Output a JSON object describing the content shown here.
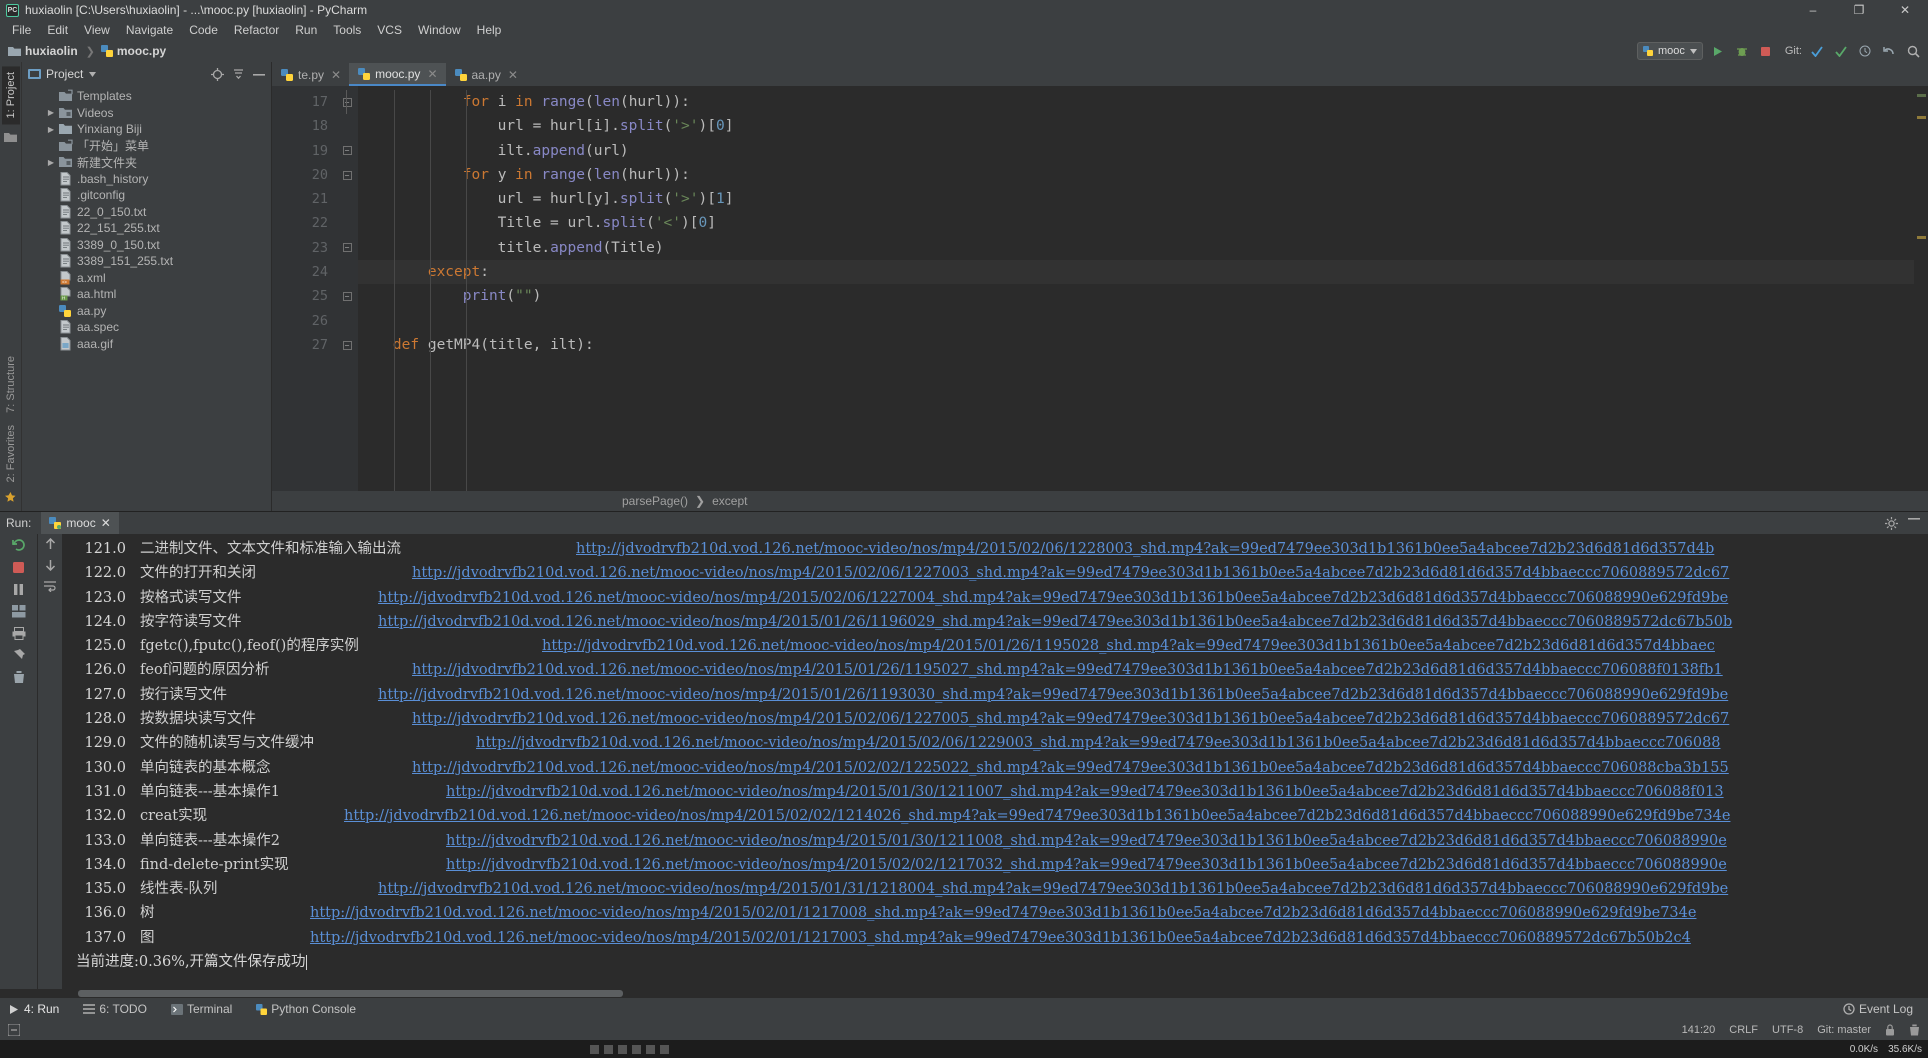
{
  "titlebar": {
    "title": "huxiaolin [C:\\Users\\huxiaolin] - ...\\mooc.py [huxiaolin] - PyCharm",
    "minimize": "–",
    "maximize": "❐",
    "close": "✕"
  },
  "menubar": {
    "items": [
      "File",
      "Edit",
      "View",
      "Navigate",
      "Code",
      "Refactor",
      "Run",
      "Tools",
      "VCS",
      "Window",
      "Help"
    ]
  },
  "navbar": {
    "crumbs": [
      "huxiaolin",
      "mooc.py"
    ],
    "run_config": "mooc",
    "git_label": "Git:"
  },
  "leftrail": {
    "project_tab": "1: Project",
    "structure_tab": "7: Structure",
    "favorites_tab": "2: Favorites"
  },
  "project": {
    "title": "Project",
    "tree": [
      {
        "label": "Templates",
        "arrow": "",
        "icon": "folder-link-icon",
        "indent": 1
      },
      {
        "label": "Videos",
        "arrow": "▶",
        "icon": "folder-special-icon",
        "indent": 1
      },
      {
        "label": "Yinxiang Biji",
        "arrow": "▶",
        "icon": "folder-icon",
        "indent": 1
      },
      {
        "label": "「开始」菜单",
        "arrow": "",
        "icon": "folder-link-icon",
        "indent": 1
      },
      {
        "label": "新建文件夹",
        "arrow": "▶",
        "icon": "folder-special-icon",
        "indent": 1
      },
      {
        "label": ".bash_history",
        "arrow": "",
        "icon": "text-file-icon",
        "indent": 1
      },
      {
        "label": ".gitconfig",
        "arrow": "",
        "icon": "text-file-icon",
        "indent": 1
      },
      {
        "label": "22_0_150.txt",
        "arrow": "",
        "icon": "text-file-icon",
        "indent": 1
      },
      {
        "label": "22_151_255.txt",
        "arrow": "",
        "icon": "text-file-icon",
        "indent": 1
      },
      {
        "label": "3389_0_150.txt",
        "arrow": "",
        "icon": "text-file-icon",
        "indent": 1
      },
      {
        "label": "3389_151_255.txt",
        "arrow": "",
        "icon": "text-file-icon",
        "indent": 1
      },
      {
        "label": "a.xml",
        "arrow": "",
        "icon": "xml-file-icon",
        "indent": 1
      },
      {
        "label": "aa.html",
        "arrow": "",
        "icon": "html-file-icon",
        "indent": 1
      },
      {
        "label": "aa.py",
        "arrow": "",
        "icon": "python-file-icon",
        "indent": 1
      },
      {
        "label": "aa.spec",
        "arrow": "",
        "icon": "text-file-icon",
        "indent": 1
      },
      {
        "label": "aaa.gif",
        "arrow": "",
        "icon": "image-file-icon",
        "indent": 1
      }
    ]
  },
  "editor": {
    "tabs": [
      {
        "label": "te.py",
        "active": false
      },
      {
        "label": "mooc.py",
        "active": true
      },
      {
        "label": "aa.py",
        "active": false
      }
    ],
    "lines": [
      {
        "num": "17",
        "fold": "─",
        "code": "            for i in range(len(hurl)):",
        "hl": false
      },
      {
        "num": "18",
        "fold": "",
        "code": "                url = hurl[i].split('>')[0]",
        "hl": false
      },
      {
        "num": "19",
        "fold": "─",
        "code": "                ilt.append(url)",
        "hl": false
      },
      {
        "num": "20",
        "fold": "─",
        "code": "            for y in range(len(hurl)):",
        "hl": false
      },
      {
        "num": "21",
        "fold": "",
        "code": "                url = hurl[y].split('>')[1]",
        "hl": false
      },
      {
        "num": "22",
        "fold": "",
        "code": "                Title = url.split('<')[0]",
        "hl": false
      },
      {
        "num": "23",
        "fold": "─",
        "code": "                title.append(Title)",
        "hl": false
      },
      {
        "num": "24",
        "fold": "",
        "code": "        except:",
        "hl": true
      },
      {
        "num": "25",
        "fold": "─",
        "code": "            print(\"\")",
        "hl": false
      },
      {
        "num": "26",
        "fold": "",
        "code": "",
        "hl": false
      },
      {
        "num": "27",
        "fold": "─",
        "code": "    def getMP4(title, ilt):",
        "hl": false
      }
    ],
    "breadcrumb": [
      "parsePage()",
      "except"
    ]
  },
  "run": {
    "label": "Run:",
    "tab": "mooc",
    "url_base": "http://jdvodrvfb210d.vod.126.net/mooc-video/nos/mp4/",
    "url_suffix": "?ak=99ed7479ee303d1b1361b0ee5a4abcee7d2b23d6d81d6d357d4bbaeccc7060889",
    "rows": [
      {
        "num": "121.0",
        "title": "二进制文件、文本文件和标准输入输出流",
        "url": "http://jdvodrvfb210d.vod.126.net/mooc-video/nos/mp4/2015/02/06/1228003_shd.mp4?ak=99ed7479ee303d1b1361b0ee5a4abcee7d2b23d6d81d6d357d4b",
        "indent": 436
      },
      {
        "num": "122.0",
        "title": "文件的打开和关闭",
        "url": "http://jdvodrvfb210d.vod.126.net/mooc-video/nos/mp4/2015/02/06/1227003_shd.mp4?ak=99ed7479ee303d1b1361b0ee5a4abcee7d2b23d6d81d6d357d4bbaeccc7060889572dc67",
        "indent": 272
      },
      {
        "num": "123.0",
        "title": "按格式读写文件",
        "url": "http://jdvodrvfb210d.vod.126.net/mooc-video/nos/mp4/2015/02/06/1227004_shd.mp4?ak=99ed7479ee303d1b1361b0ee5a4abcee7d2b23d6d81d6d357d4bbaeccc706088990e629fd9be",
        "indent": 238
      },
      {
        "num": "124.0",
        "title": "按字符读写文件",
        "url": "http://jdvodrvfb210d.vod.126.net/mooc-video/nos/mp4/2015/01/26/1196029_shd.mp4?ak=99ed7479ee303d1b1361b0ee5a4abcee7d2b23d6d81d6d357d4bbaeccc7060889572dc67b50b",
        "indent": 238
      },
      {
        "num": "125.0",
        "title": "fgetc(),fputc(),feof()的程序实例",
        "url": "http://jdvodrvfb210d.vod.126.net/mooc-video/nos/mp4/2015/01/26/1195028_shd.mp4?ak=99ed7479ee303d1b1361b0ee5a4abcee7d2b23d6d81d6d357d4bbaec",
        "indent": 402
      },
      {
        "num": "126.0",
        "title": "feof问题的原因分析",
        "url": "http://jdvodrvfb210d.vod.126.net/mooc-video/nos/mp4/2015/01/26/1195027_shd.mp4?ak=99ed7479ee303d1b1361b0ee5a4abcee7d2b23d6d81d6d357d4bbaeccc706088f0138fb1",
        "indent": 272
      },
      {
        "num": "127.0",
        "title": "按行读写文件",
        "url": "http://jdvodrvfb210d.vod.126.net/mooc-video/nos/mp4/2015/01/26/1193030_shd.mp4?ak=99ed7479ee303d1b1361b0ee5a4abcee7d2b23d6d81d6d357d4bbaeccc706088990e629fd9be",
        "indent": 238
      },
      {
        "num": "128.0",
        "title": "按数据块读写文件",
        "url": "http://jdvodrvfb210d.vod.126.net/mooc-video/nos/mp4/2015/02/06/1227005_shd.mp4?ak=99ed7479ee303d1b1361b0ee5a4abcee7d2b23d6d81d6d357d4bbaeccc7060889572dc67",
        "indent": 272
      },
      {
        "num": "129.0",
        "title": "文件的随机读写与文件缓冲",
        "url": "http://jdvodrvfb210d.vod.126.net/mooc-video/nos/mp4/2015/02/06/1229003_shd.mp4?ak=99ed7479ee303d1b1361b0ee5a4abcee7d2b23d6d81d6d357d4bbaeccc706088",
        "indent": 336
      },
      {
        "num": "130.0",
        "title": "单向链表的基本概念",
        "url": "http://jdvodrvfb210d.vod.126.net/mooc-video/nos/mp4/2015/02/02/1225022_shd.mp4?ak=99ed7479ee303d1b1361b0ee5a4abcee7d2b23d6d81d6d357d4bbaeccc706088cba3b155",
        "indent": 272
      },
      {
        "num": "131.0",
        "title": "单向链表---基本操作1",
        "url": "http://jdvodrvfb210d.vod.126.net/mooc-video/nos/mp4/2015/01/30/1211007_shd.mp4?ak=99ed7479ee303d1b1361b0ee5a4abcee7d2b23d6d81d6d357d4bbaeccc706088f013",
        "indent": 306
      },
      {
        "num": "132.0",
        "title": "creat实现",
        "url": "http://jdvodrvfb210d.vod.126.net/mooc-video/nos/mp4/2015/02/02/1214026_shd.mp4?ak=99ed7479ee303d1b1361b0ee5a4abcee7d2b23d6d81d6d357d4bbaeccc706088990e629fd9be734e",
        "indent": 204
      },
      {
        "num": "133.0",
        "title": "单向链表---基本操作2",
        "url": "http://jdvodrvfb210d.vod.126.net/mooc-video/nos/mp4/2015/01/30/1211008_shd.mp4?ak=99ed7479ee303d1b1361b0ee5a4abcee7d2b23d6d81d6d357d4bbaeccc706088990e",
        "indent": 306
      },
      {
        "num": "134.0",
        "title": "find-delete-print实现",
        "url": "http://jdvodrvfb210d.vod.126.net/mooc-video/nos/mp4/2015/02/02/1217032_shd.mp4?ak=99ed7479ee303d1b1361b0ee5a4abcee7d2b23d6d81d6d357d4bbaeccc706088990e",
        "indent": 306
      },
      {
        "num": "135.0",
        "title": "线性表-队列",
        "url": "http://jdvodrvfb210d.vod.126.net/mooc-video/nos/mp4/2015/01/31/1218004_shd.mp4?ak=99ed7479ee303d1b1361b0ee5a4abcee7d2b23d6d81d6d357d4bbaeccc706088990e629fd9be",
        "indent": 238
      },
      {
        "num": "136.0",
        "title": "树",
        "url": "http://jdvodrvfb210d.vod.126.net/mooc-video/nos/mp4/2015/02/01/1217008_shd.mp4?ak=99ed7479ee303d1b1361b0ee5a4abcee7d2b23d6d81d6d357d4bbaeccc706088990e629fd9be734e",
        "indent": 170
      },
      {
        "num": "137.0",
        "title": "图",
        "url": "http://jdvodrvfb210d.vod.126.net/mooc-video/nos/mp4/2015/02/01/1217003_shd.mp4?ak=99ed7479ee303d1b1361b0ee5a4abcee7d2b23d6d81d6d357d4bbaeccc7060889572dc67b50b2c4",
        "indent": 170
      }
    ],
    "final_line": "当前进度:0.36%,开篇文件保存成功"
  },
  "toolwindow_bar": {
    "items": [
      {
        "label": "4: Run",
        "icon": "play-icon",
        "active": true
      },
      {
        "label": "6: TODO",
        "icon": "todo-icon",
        "active": false
      },
      {
        "label": "Terminal",
        "icon": "terminal-icon",
        "active": false
      },
      {
        "label": "Python Console",
        "icon": "python-icon",
        "active": false
      }
    ],
    "event_log": "Event Log"
  },
  "statusbar": {
    "caret": "141:20",
    "line_sep": "CRLF",
    "encoding": "UTF-8",
    "git_branch": "Git: master"
  },
  "taskbar": {
    "net_speed": "0.0K/s",
    "down_speed": "35.6K/s"
  },
  "colors": {
    "accent": "#4a88c7",
    "link": "#5a8fd6",
    "bg": "#3c3f41",
    "editor_bg": "#2b2b2b",
    "keyword": "#cc7832",
    "string": "#6a8759",
    "number": "#6897bb"
  }
}
